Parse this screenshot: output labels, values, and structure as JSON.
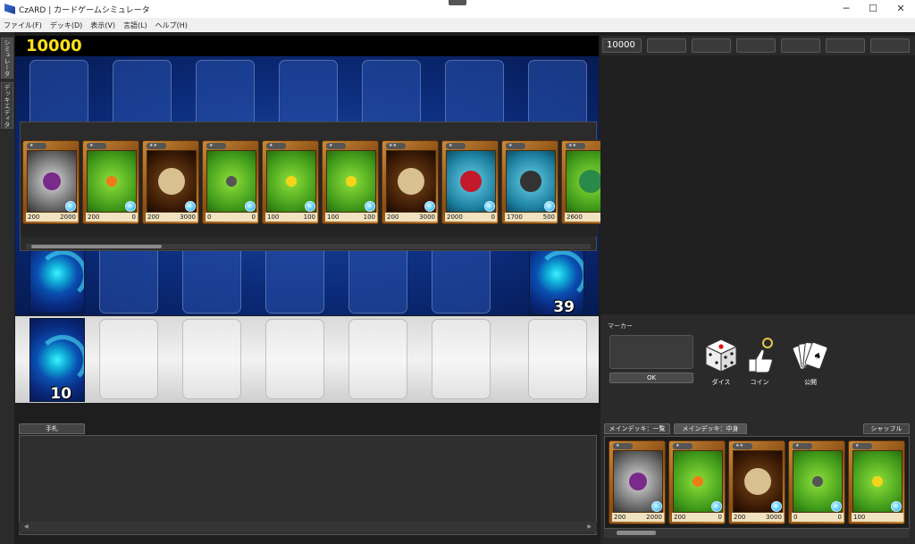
{
  "window": {
    "title": "CzARD | カードゲームシミュレータ",
    "minimize_icon": "─",
    "maximize_icon": "☐",
    "close_icon": "✕"
  },
  "menu": [
    "ファイル(F)",
    "デッキ(D)",
    "表示(V)",
    "言語(L)",
    "ヘルプ(H)"
  ],
  "side_tabs": [
    "シミュレータ",
    "デッキエディタ"
  ],
  "score": "10000",
  "opponent_deck_count": "39",
  "my_deck_count": "10",
  "viewer_cards": [
    {
      "level": "★",
      "left": "200",
      "right": "2000",
      "art": "ghost"
    },
    {
      "level": "★",
      "left": "200",
      "right": "0",
      "art": "sprout-orange"
    },
    {
      "level": "★★",
      "left": "200",
      "right": "3000",
      "art": "golem"
    },
    {
      "level": "★",
      "left": "0",
      "right": "0",
      "art": "sprout-gray"
    },
    {
      "level": "★",
      "left": "100",
      "right": "100",
      "art": "sprout-yellow"
    },
    {
      "level": "★",
      "left": "100",
      "right": "100",
      "art": "sprout-yellow"
    },
    {
      "level": "★★",
      "left": "200",
      "right": "3000",
      "art": "golem"
    },
    {
      "level": "★",
      "left": "2000",
      "right": "0",
      "art": "knight"
    },
    {
      "level": "★",
      "left": "1700",
      "right": "500",
      "art": "bomb"
    },
    {
      "level": "★★",
      "left": "2600",
      "right": "",
      "art": "dragon"
    }
  ],
  "right_panel": {
    "score_boxes": [
      "10000",
      "",
      "",
      "",
      "",
      "",
      ""
    ],
    "marker_label": "マーカー",
    "ok_label": "OK",
    "tools": [
      {
        "label": "ダイス",
        "icon": "dice-icon"
      },
      {
        "label": "コイン",
        "icon": "coin-icon"
      },
      {
        "label": "公開",
        "icon": "cards-icon"
      }
    ]
  },
  "hand": {
    "tab_label": "手札",
    "scroll_left": "◀",
    "scroll_right": "▶"
  },
  "deck_panel": {
    "tabs": [
      "メインデッキ：一覧",
      "メインデッキ：中身"
    ],
    "shuffle_label": "シャッフル",
    "cards": [
      {
        "level": "★",
        "left": "200",
        "right": "2000",
        "art": "ghost"
      },
      {
        "level": "★",
        "left": "200",
        "right": "0",
        "art": "sprout-orange"
      },
      {
        "level": "★★",
        "left": "200",
        "right": "3000",
        "art": "golem"
      },
      {
        "level": "★",
        "left": "0",
        "right": "0",
        "art": "sprout-gray"
      },
      {
        "level": "★",
        "left": "100",
        "right": "",
        "art": "sprout-yellow"
      }
    ]
  }
}
